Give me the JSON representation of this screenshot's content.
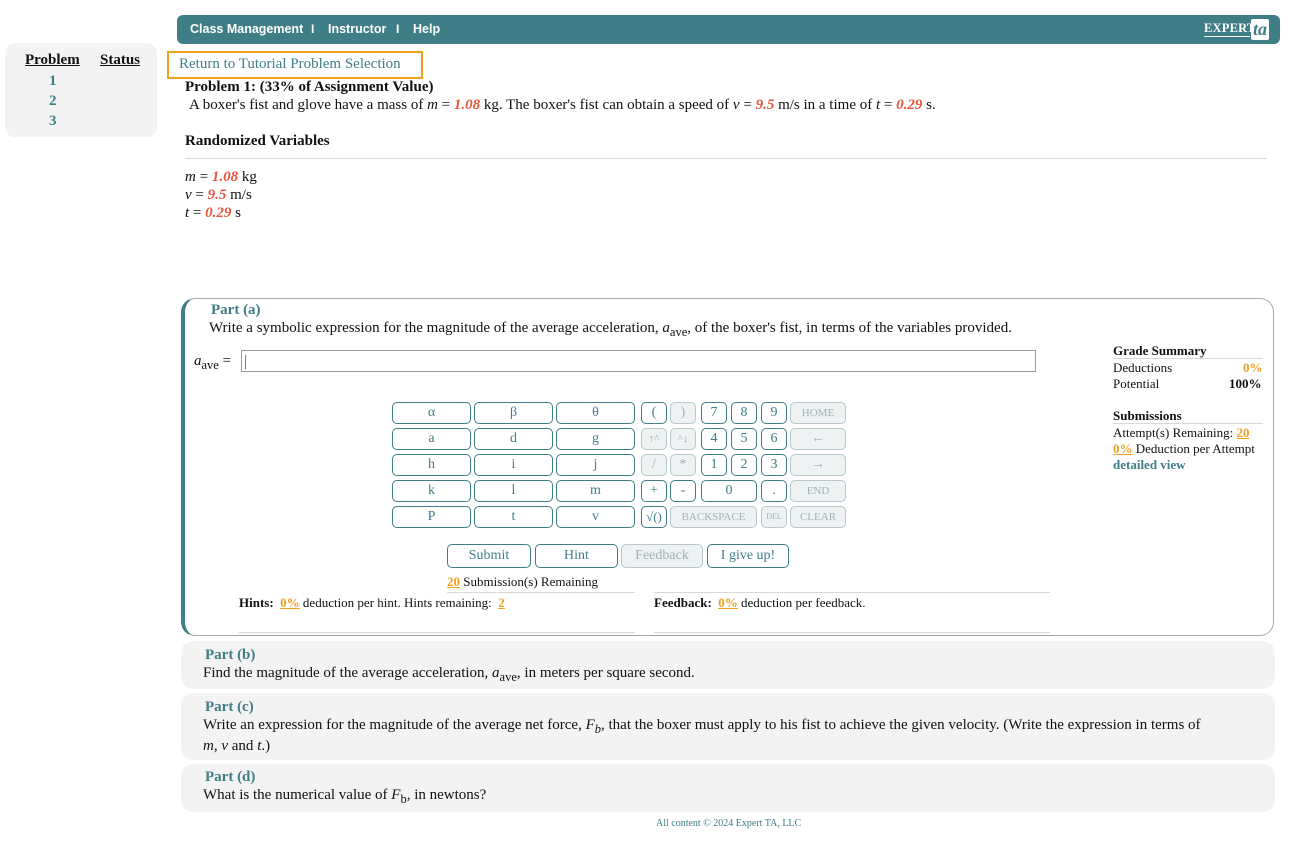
{
  "nav": {
    "items": [
      "Class Management",
      "Instructor",
      "Help"
    ],
    "separator": "I",
    "logo_text": "EXPERT",
    "logo_mark": "ta"
  },
  "problem_list": {
    "header_problem": "Problem",
    "header_status": "Status",
    "items": [
      "1",
      "2",
      "3"
    ]
  },
  "return_link": "Return to Tutorial Problem Selection",
  "problem": {
    "title": "Problem 1: (33% of Assignment Value)",
    "statement": {
      "p1": "A boxer's fist and glove have a mass of ",
      "m_var": "m",
      "eq": " = ",
      "m_val": "1.08",
      "p2": " kg. The boxer's fist can obtain a speed of ",
      "v_var": "v",
      "v_val": "9.5",
      "p3": " m/s in a time of ",
      "t_var": "t",
      "t_val": "0.29",
      "p4": " s."
    }
  },
  "randomized": {
    "heading": "Randomized Variables",
    "rows": [
      {
        "var": "m",
        "eq": " = ",
        "val": "1.08",
        "unit": " kg"
      },
      {
        "var": "v",
        "eq": " = ",
        "val": "9.5",
        "unit": " m/s"
      },
      {
        "var": "t",
        "eq": " = ",
        "val": "0.29",
        "unit": " s"
      }
    ]
  },
  "part_a": {
    "title": "Part (a)",
    "q1": "Write a symbolic expression for the magnitude of the average acceleration, ",
    "qvar": "a",
    "qsub": "ave",
    "q2": ", of the boxer's fist, in terms of the variables provided.",
    "input_var": "a",
    "input_sub": "ave",
    "input_eq": " =",
    "input_value": "",
    "keys": {
      "greek": [
        "α",
        "β",
        "θ"
      ],
      "vars": [
        "a",
        "d",
        "g",
        "h",
        "i",
        "j",
        "k",
        "l",
        "m",
        "P",
        "t",
        "v"
      ],
      "paren_open": "(",
      "paren_close": ")",
      "digits": [
        "7",
        "8",
        "9",
        "4",
        "5",
        "6",
        "1",
        "2",
        "3",
        "0"
      ],
      "up": "↑^",
      "down": "^↓",
      "divide": "/",
      "multiply": "*",
      "plus": "+",
      "minus": "-",
      "dot": ".",
      "sqrt": "√()",
      "home": "HOME",
      "left": "←",
      "right": "→",
      "end": "END",
      "backspace": "BACKSPACE",
      "del": "DEL",
      "clear": "CLEAR"
    },
    "buttons": {
      "submit": "Submit",
      "hint": "Hint",
      "feedback": "Feedback",
      "giveup": "I give up!"
    },
    "submissions_count": "20",
    "submissions_label": " Submission(s) Remaining",
    "hints_label": "Hints:",
    "hints_deduction": "0%",
    "hints_text": " deduction per hint. Hints remaining: ",
    "hints_remaining": "2",
    "feedback_label": "Feedback:",
    "feedback_deduction": "0%",
    "feedback_text": " deduction per feedback."
  },
  "grade_summary": {
    "heading": "Grade Summary",
    "deductions_label": "Deductions",
    "deductions_value": "0%",
    "potential_label": "Potential",
    "potential_value": "100%",
    "submissions_heading": "Submissions",
    "attempts_label": "Attempt(s) Remaining: ",
    "attempts_value": "20",
    "deduction_attempt_value": "0%",
    "deduction_attempt_label": " Deduction per Attempt",
    "detailed_view": "detailed view"
  },
  "part_b": {
    "title": "Part (b)",
    "q1": "Find the magnitude of the average acceleration, ",
    "qvar": "a",
    "qsub": "ave",
    "q2": ", in meters per square second."
  },
  "part_c": {
    "title": "Part (c)",
    "q1": "Write an expression for the magnitude of the average net force, ",
    "qvar": "F",
    "qsub": "b",
    "q2": ", that the boxer must apply to his fist to achieve the given velocity. (Write the expression in terms of",
    "l2_m": "m",
    "l2_comma": ", ",
    "l2_v": "v",
    "l2_and": " and ",
    "l2_t": "t",
    "l2_end": ".)"
  },
  "part_d": {
    "title": "Part (d)",
    "q1": "What is the numerical value of ",
    "qvar": "F",
    "qsub": "b",
    "q2": ", in newtons?"
  },
  "footer": "All content © 2024 Expert TA, LLC"
}
